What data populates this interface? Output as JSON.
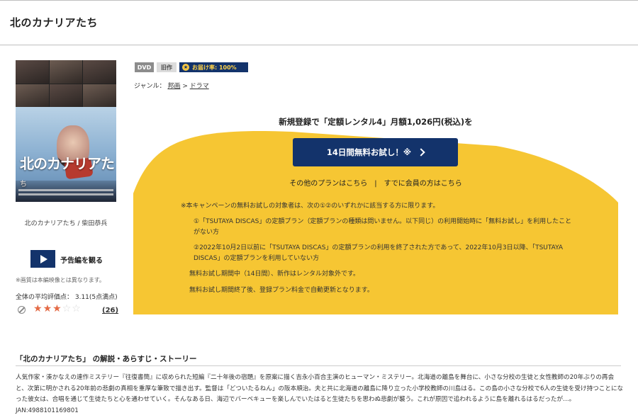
{
  "page": {
    "title": "北のカナリアたち"
  },
  "poster": {
    "title_main": "北のカナリアた",
    "title_small": "ち"
  },
  "left": {
    "caption": "北のカナリアたち / 柴田恭兵",
    "trailer_label": "予告編を観る",
    "note": "※画質は本編映像とは異なります。",
    "avg_rating": "全体の平均評価点： 3.11(5点満点)",
    "stars_filled": 3,
    "stars_total": 5,
    "review_count": "(26)"
  },
  "badges": {
    "dvd": "DVD",
    "old": "旧作",
    "rate": "お届け率: 100%"
  },
  "genre": {
    "label": "ジャンル：",
    "items": [
      "邦画",
      "ドラマ"
    ],
    "sep": " > "
  },
  "promo": {
    "headline": "新規登録で「定額レンタル4」月額1,026円(税込)を",
    "button_label": "14日間無料お試し！※",
    "link_other_plans": "その他のプランはこちら",
    "link_sep": "|",
    "link_members": "すでに会員の方はこちら",
    "bg_color": "#f6c633",
    "terms": [
      "※本キャンペーンの無料お試しの対象者は、次の①②のいずれかに該当する方に限ります。",
      "①「TSUTAYA DISCAS」の定額プラン（定額プランの種類は問いません。以下同じ）の利用開始時に「無料お試し」を利用したことがない方",
      "②2022年10月2日以前に「TSUTAYA DISCAS」の定額プランの利用を終了された方であって、2022年10月3日以降、「TSUTAYA DISCAS」の定額プランを利用していない方",
      "無料お試し期間中（14日間）、新作はレンタル対象外です。",
      "無料お試し期間終了後、登録プラン料金で自動更新となります。"
    ]
  },
  "story": {
    "heading": "「北のカナリアたち」 の解説・あらすじ・ストーリー",
    "body": "人気作家・湊かなえの連作ミステリー『往復書簡』に収められた短編『二十年後の宿題』を原案に描く吉永小百合主演のヒューマン・ミステリー。北海道の離島を舞台に、小さな分校の生徒と女性教師の20年ぶりの再会と、次第に明かされる20年前の悲劇の真相を重厚な筆致で描き出す。監督は「どついたるねん」の阪本順治。夫と共に北海道の離島に降り立った小学校教師の川島はる。この島の小さな分校で6人の生徒を受け持つことになった彼女は、合唱を通じて生徒たちと心を通わせていく。そんなある日、海辺でバーベキューを楽しんでいたはると生徒たちを思わぬ悲劇が襲う。これが原因で追われるように島を離れるはるだったが…。 JAN:4988101169801"
  },
  "colors": {
    "navy": "#13336b",
    "yellow": "#f6c633",
    "star": "#e46a45"
  }
}
